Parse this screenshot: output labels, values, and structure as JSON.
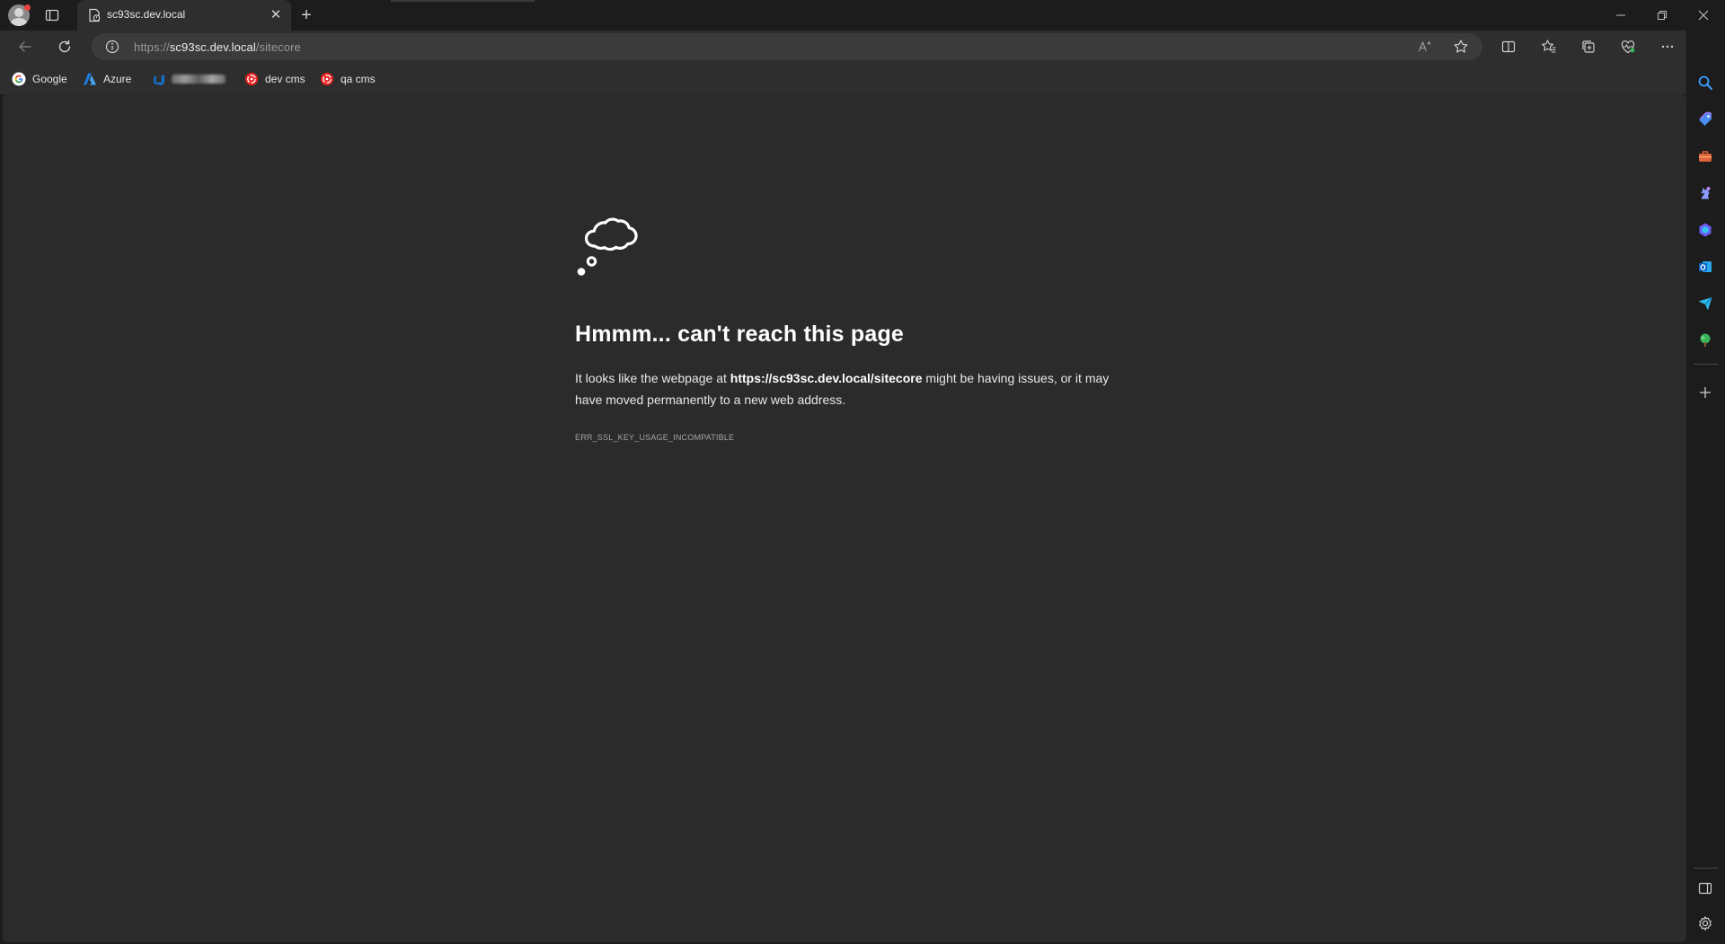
{
  "tab": {
    "title": "sc93sc.dev.local"
  },
  "address_bar": {
    "scheme": "https://",
    "host": "sc93sc.dev.local",
    "path": "/sitecore"
  },
  "favorites": [
    {
      "label": "Google",
      "icon": "google-icon"
    },
    {
      "label": "Azure",
      "icon": "azure-icon"
    },
    {
      "label": "",
      "icon": "devops-icon"
    },
    {
      "label": "dev cms",
      "icon": "sitecore-icon"
    },
    {
      "label": "qa cms",
      "icon": "sitecore-icon"
    }
  ],
  "error_page": {
    "title": "Hmmm... can't reach this page",
    "message_before": "It looks like the webpage at ",
    "message_url": "https://sc93sc.dev.local/sitecore",
    "message_after": " might be having issues, or it may have moved permanently to a new web address.",
    "error_code": "ERR_SSL_KEY_USAGE_INCOMPATIBLE"
  },
  "colors": {
    "page_background": "#2b2b2b",
    "chrome_background": "#2e2e2e",
    "frame_background": "#1c1c1c",
    "accent_blue": "#3b8fe0"
  }
}
